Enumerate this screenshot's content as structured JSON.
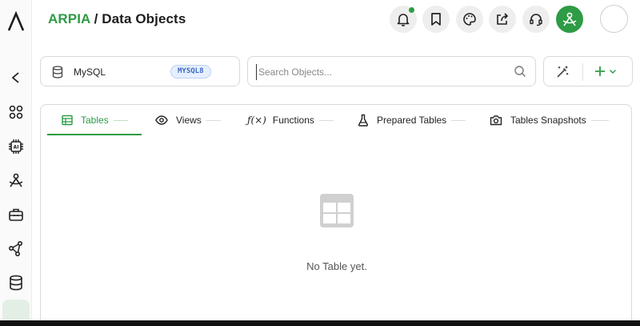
{
  "header": {
    "brand": "ARPIA",
    "separator": " / ",
    "section": "Data Objects"
  },
  "sidebar": {
    "items": [
      {
        "name": "back",
        "icon": "chevron-left-icon"
      },
      {
        "name": "apps",
        "icon": "grid-dots-icon"
      },
      {
        "name": "ai",
        "icon": "ai-chip-icon"
      },
      {
        "name": "people",
        "icon": "user-compass-icon"
      },
      {
        "name": "toolbox",
        "icon": "toolbox-icon"
      },
      {
        "name": "share",
        "icon": "network-icon"
      },
      {
        "name": "database",
        "icon": "database-icon"
      }
    ]
  },
  "header_buttons": [
    "bell-icon",
    "bookmark-icon",
    "palette-icon",
    "share-icon",
    "headset-icon",
    "user-compass-icon"
  ],
  "toolbar": {
    "db_name": "MySQL",
    "db_badge": "MYSQL8",
    "search_placeholder": "Search Objects...",
    "search_value": ""
  },
  "tabs": [
    {
      "label": "Tables",
      "icon": "table-icon",
      "active": true
    },
    {
      "label": "Views",
      "icon": "eye-icon",
      "active": false
    },
    {
      "label": "Functions",
      "icon": "function-icon",
      "active": false
    },
    {
      "label": "Prepared Tables",
      "icon": "flask-icon",
      "active": false
    },
    {
      "label": "Tables Snapshots",
      "icon": "camera-icon",
      "active": false
    }
  ],
  "empty_state": {
    "icon": "table-icon",
    "message": "No Table yet."
  },
  "colors": {
    "accent": "#2e9b45",
    "badge_text": "#3a6bc7",
    "badge_bg": "#e6efff"
  }
}
